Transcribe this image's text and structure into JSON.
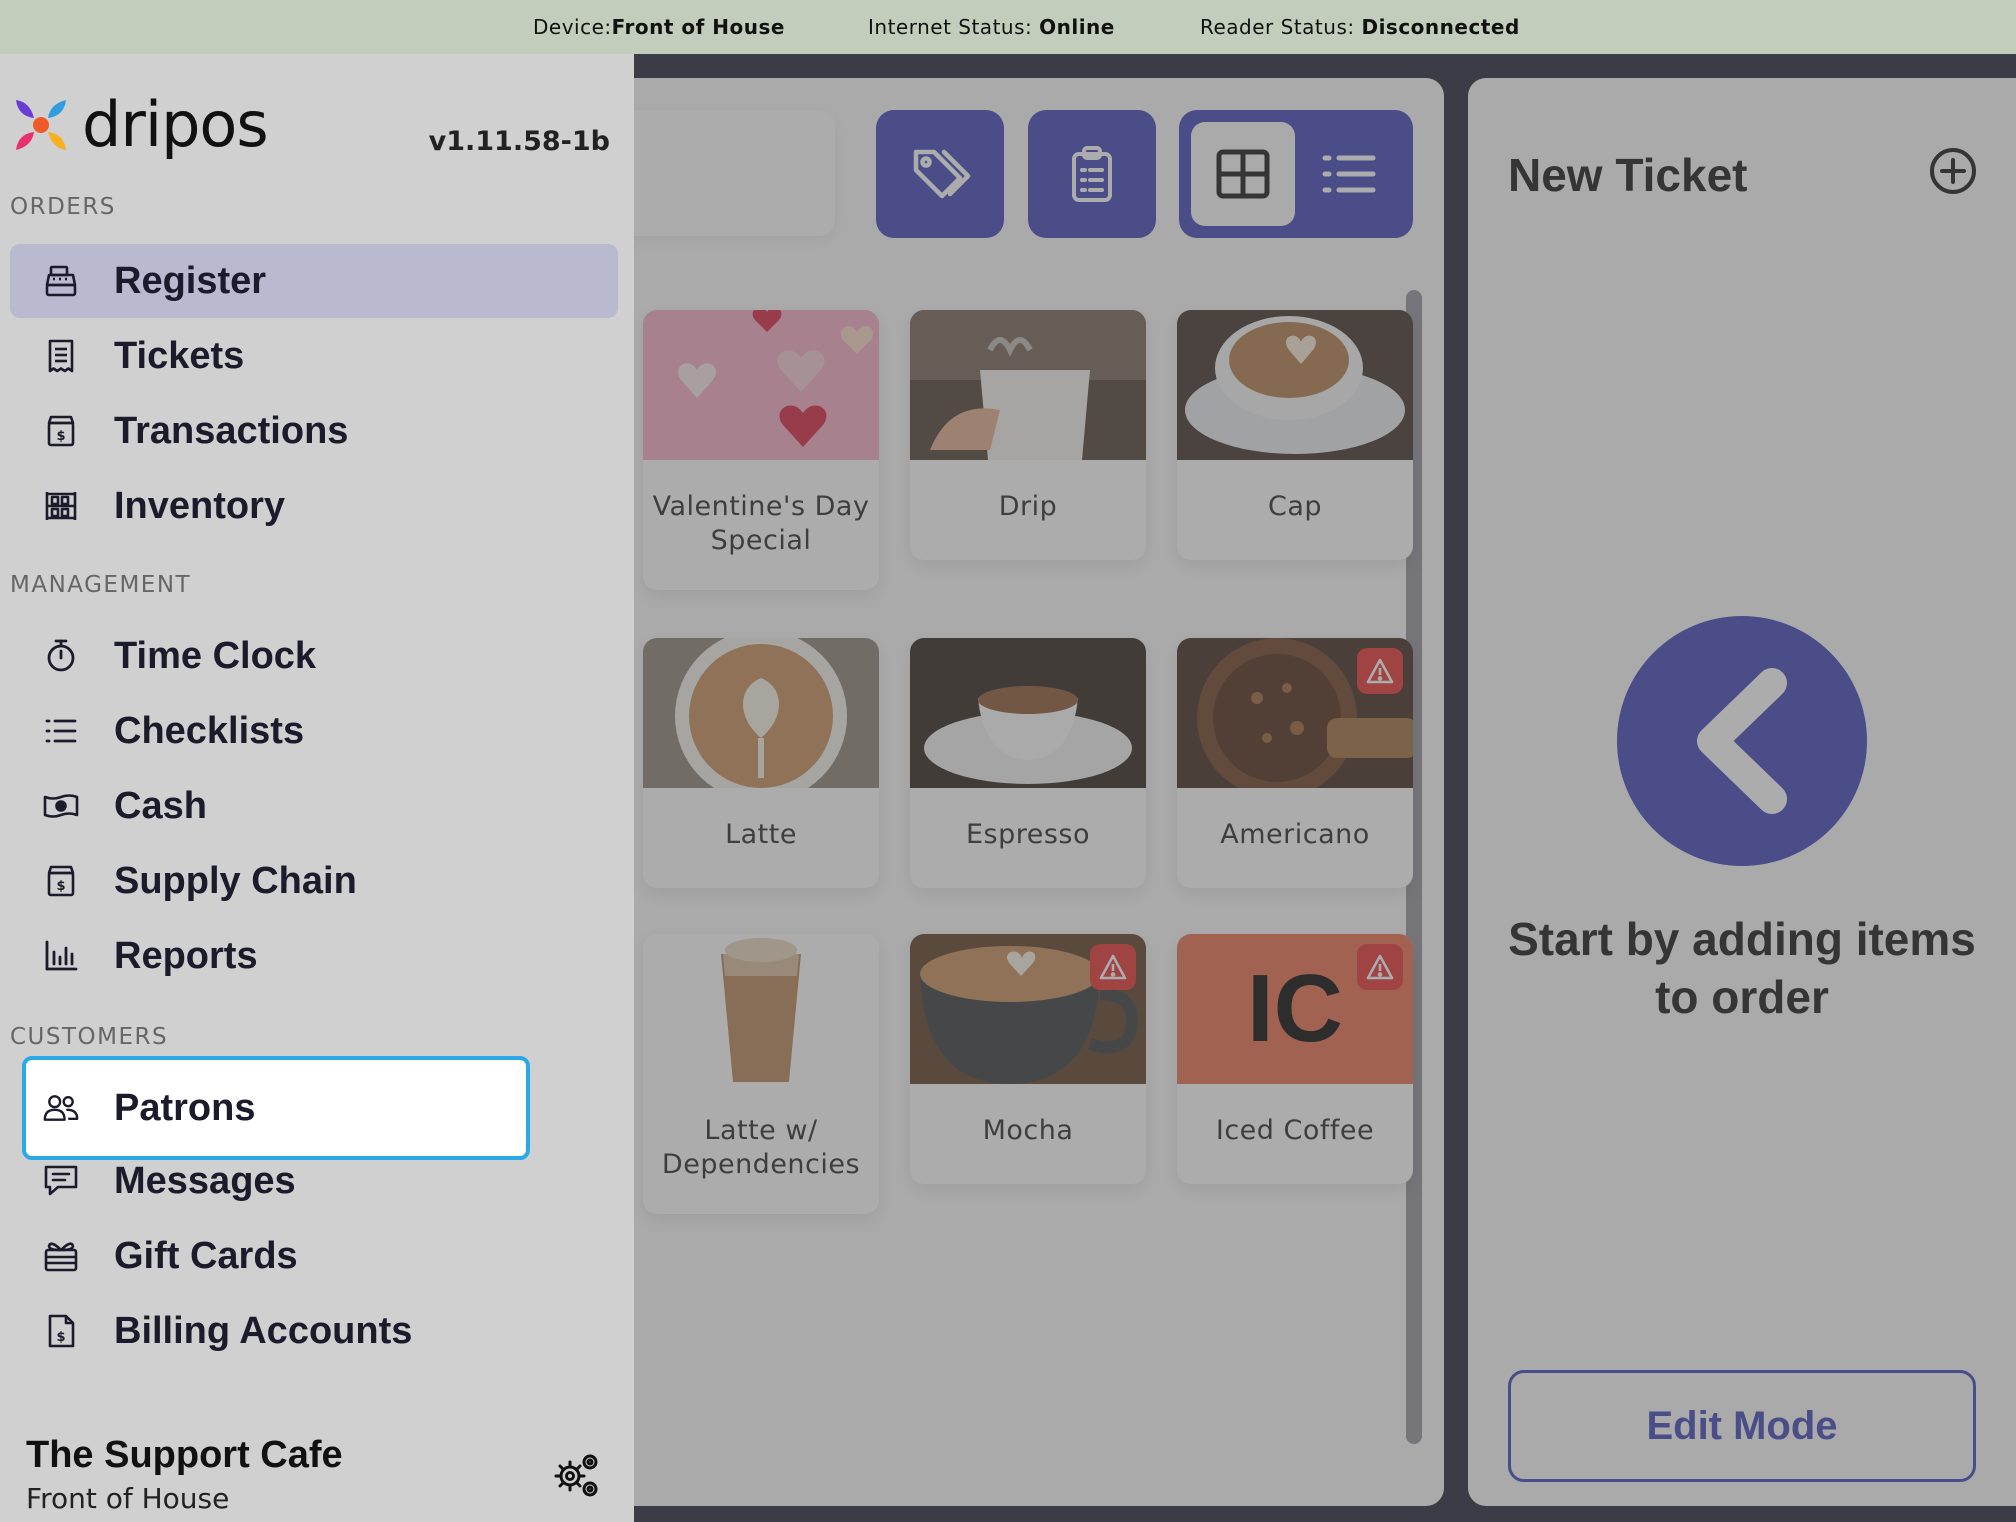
{
  "status_bar": {
    "device_label": "Device:",
    "device_value": "Front of House",
    "internet_label": "Internet Status: ",
    "internet_value": "Online",
    "reader_label": "Reader Status: ",
    "reader_value": "Disconnected"
  },
  "sidebar": {
    "brand": "dripos",
    "version": "v1.11.58-1b",
    "sections": {
      "orders": "ORDERS",
      "management": "MANAGEMENT",
      "customers": "CUSTOMERS"
    },
    "items": {
      "register": "Register",
      "tickets": "Tickets",
      "transactions": "Transactions",
      "inventory": "Inventory",
      "time_clock": "Time Clock",
      "checklists": "Checklists",
      "cash": "Cash",
      "supply_chain": "Supply Chain",
      "reports": "Reports",
      "patrons": "Patrons",
      "messages": "Messages",
      "gift_cards": "Gift Cards",
      "billing_accounts": "Billing Accounts"
    },
    "footer": {
      "cafe_name": "The Support Cafe",
      "device_name": "Front of House"
    }
  },
  "menu_items": [
    {
      "name": "Valentine's Day Special",
      "warning": false
    },
    {
      "name": "Drip",
      "warning": false
    },
    {
      "name": "Cap",
      "warning": false
    },
    {
      "name": "Latte",
      "warning": false
    },
    {
      "name": "Espresso",
      "warning": false
    },
    {
      "name": "Americano",
      "warning": true
    },
    {
      "name": "Latte w/ Dependencies",
      "warning": false
    },
    {
      "name": "Mocha",
      "warning": true
    },
    {
      "name": "Iced Coffee",
      "warning": true,
      "placeholder_text": "IC"
    }
  ],
  "ticket": {
    "title": "New Ticket",
    "empty_message": "Start by adding items to order",
    "edit_mode_label": "Edit Mode"
  },
  "colors": {
    "accent": "#3b41b7",
    "highlight_border": "#29a9e8",
    "warning": "#e52c2c",
    "status_bar": "#c3cdbb",
    "sidebar_bg": "#d0d0d0",
    "active_item_bg": "#b9b9cf"
  },
  "icons": {
    "toolbar": [
      "tag-icon",
      "clipboard-icon",
      "grid-view-icon",
      "list-view-icon"
    ],
    "ticket": [
      "plus-circle-icon",
      "chevron-left-icon"
    ]
  }
}
